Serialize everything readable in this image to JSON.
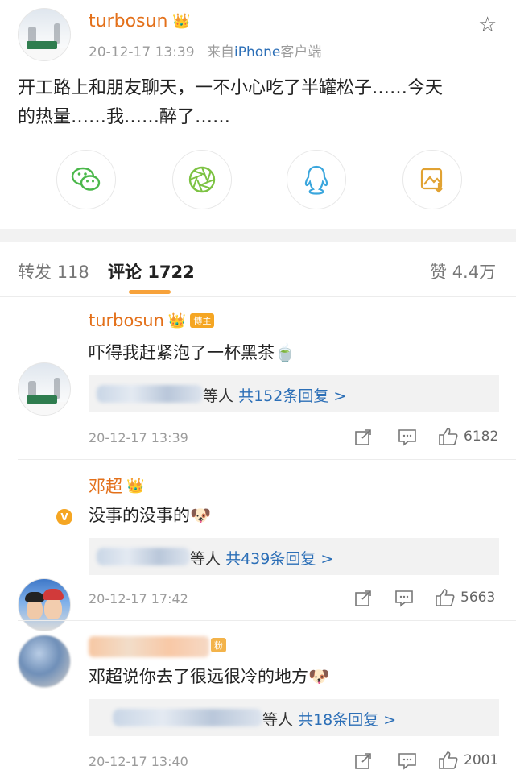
{
  "post": {
    "username": "turbosun",
    "timestamp": "20-12-17 13:39",
    "source_prefix": "来自",
    "source_device": "iPhone",
    "source_suffix": "客户端",
    "text_line1": "开工路上和朋友聊天，一不小心吃了半罐松子……今天",
    "text_line2": "的热量……我……醉了……",
    "icons": {
      "verified": "crown-icon",
      "favorite": "star-icon",
      "share": [
        "wechat-icon",
        "moments-icon",
        "qq-icon",
        "save-image-icon"
      ]
    }
  },
  "tabs": {
    "repost_label": "转发",
    "repost_count": "118",
    "comment_label": "评论",
    "comment_count": "1722",
    "like_label": "赞",
    "like_count": "4.4万"
  },
  "comments": [
    {
      "name": "turbosun",
      "tag": "博主",
      "text": "吓得我赶紧泡了一杯黑茶",
      "emoji": "🍵",
      "reply_suffix": "等人",
      "reply_count_text": "共152条回复 >",
      "time": "20-12-17 13:39",
      "likes": "6182"
    },
    {
      "name": "邓超",
      "text": "没事的没事的",
      "emoji": "🐶",
      "reply_suffix": "等人",
      "reply_count_text": "共439条回复 >",
      "time": "20-12-17 17:42",
      "likes": "5663"
    },
    {
      "tag": "粉",
      "text": "邓超说你去了很远很冷的地方",
      "emoji": "🐶",
      "reply_suffix": "等人",
      "reply_count_text": "共18条回复 >",
      "time": "20-12-17 13:40",
      "likes": "2001"
    }
  ],
  "colors": {
    "accent": "#e3701a",
    "link": "#2c6fb7",
    "tab_underline": "#f7a23b"
  }
}
